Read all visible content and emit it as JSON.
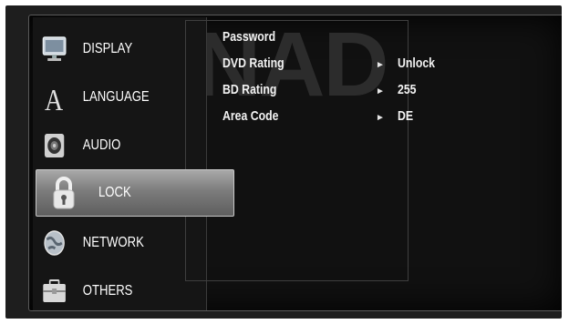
{
  "watermark": "NAD",
  "menu": {
    "items": [
      {
        "label": "DISPLAY",
        "icon": "display-icon"
      },
      {
        "label": "LANGUAGE",
        "icon": "language-icon"
      },
      {
        "label": "AUDIO",
        "icon": "audio-icon"
      },
      {
        "label": "LOCK",
        "icon": "lock-icon",
        "selected": true
      },
      {
        "label": "NETWORK",
        "icon": "network-icon"
      },
      {
        "label": "OTHERS",
        "icon": "others-icon"
      }
    ]
  },
  "settings": {
    "rows": [
      {
        "label": "Password",
        "value": ""
      },
      {
        "label": "DVD Rating",
        "value": "Unlock"
      },
      {
        "label": "BD Rating",
        "value": "255"
      },
      {
        "label": "Area Code",
        "value": "DE"
      }
    ],
    "arrow_glyph": "►"
  },
  "colors": {
    "selection": "#8f8f8f",
    "background": "#111111",
    "text": "#ffffff"
  }
}
